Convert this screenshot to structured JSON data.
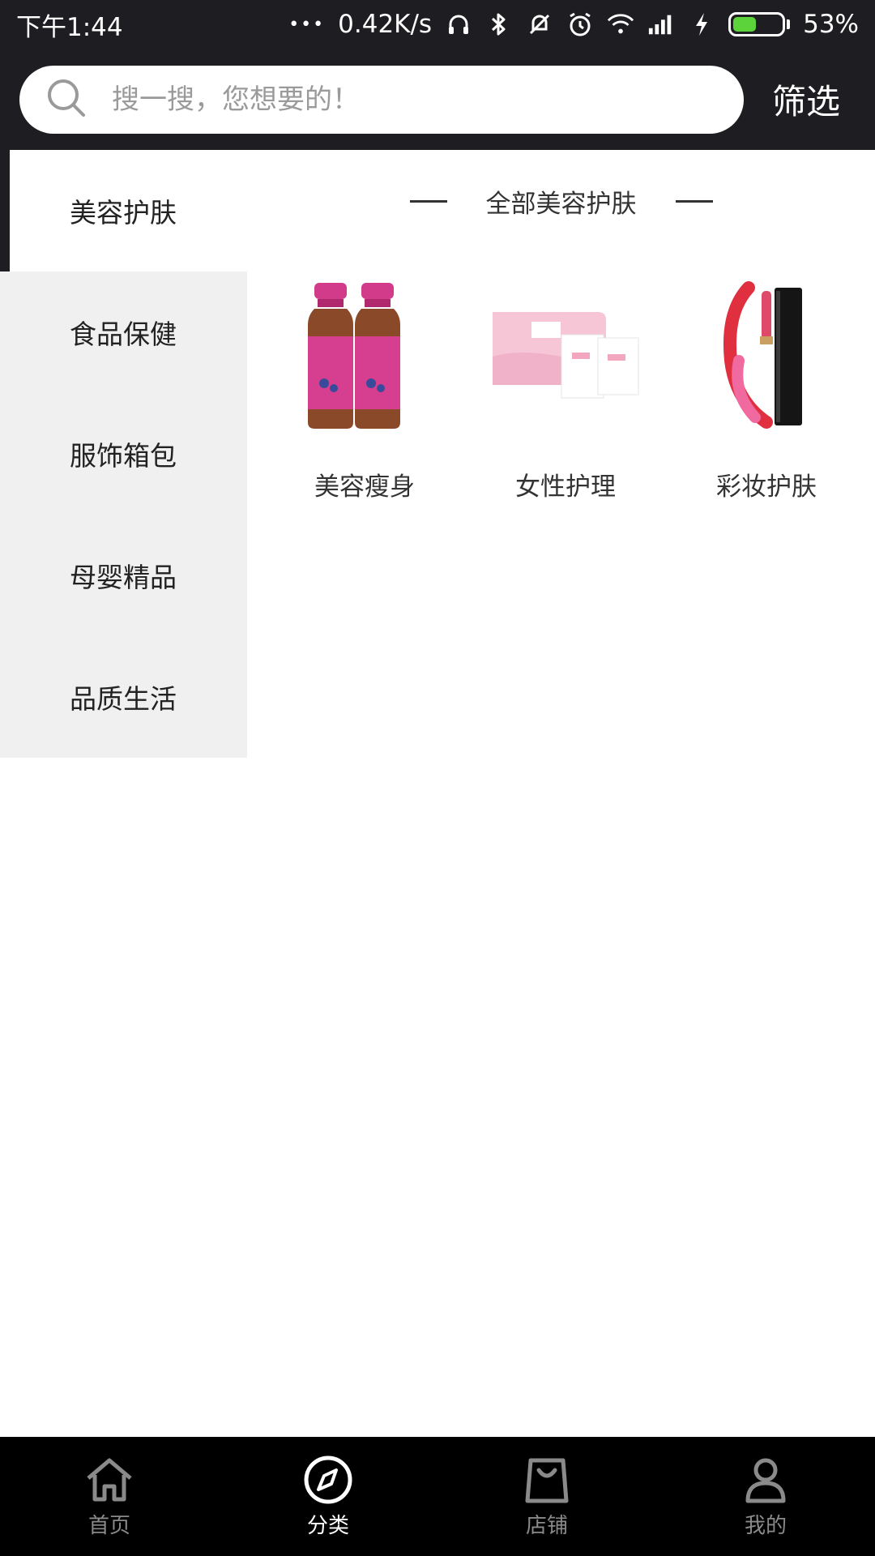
{
  "status_bar": {
    "time": "下午1:44",
    "dots": "•••",
    "speed": "0.42K/s",
    "battery": "53%",
    "battery_level": 0.53,
    "battery_color": "#5cd23b"
  },
  "search": {
    "placeholder": "搜一搜，您想要的！",
    "filter_label": "筛选"
  },
  "sidebar": {
    "items": [
      {
        "label": "美容护肤",
        "active": true
      },
      {
        "label": "食品保健",
        "active": false
      },
      {
        "label": "服饰箱包",
        "active": false
      },
      {
        "label": "母婴精品",
        "active": false
      },
      {
        "label": "品质生活",
        "active": false
      }
    ]
  },
  "content": {
    "title": "全部美容护肤",
    "products": [
      {
        "name": "美容瘦身"
      },
      {
        "name": "女性护理"
      },
      {
        "name": "彩妆护肤"
      }
    ]
  },
  "nav": {
    "items": [
      {
        "label": "首页",
        "active": false
      },
      {
        "label": "分类",
        "active": true
      },
      {
        "label": "店铺",
        "active": false
      },
      {
        "label": "我的",
        "active": false
      }
    ]
  },
  "colors": {
    "header_bg": "#1e1e22",
    "sidebar_bg": "#f0f0f0",
    "nav_bg": "#000000"
  }
}
